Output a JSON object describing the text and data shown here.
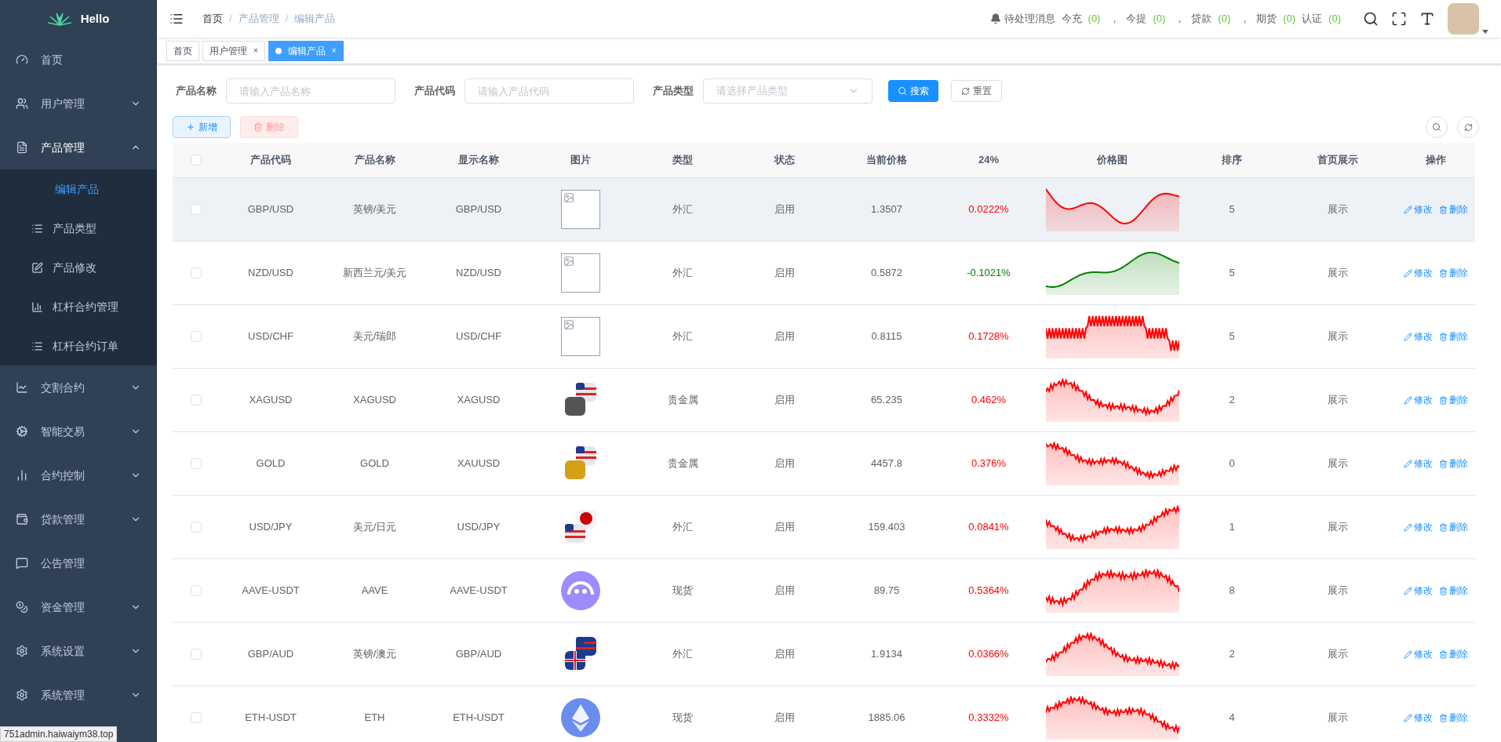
{
  "brand": {
    "name": "Hello"
  },
  "sidebar": {
    "items": [
      {
        "label": "首页",
        "kind": "link"
      },
      {
        "label": "用户管理",
        "kind": "group",
        "expanded": false
      },
      {
        "label": "产品管理",
        "kind": "group",
        "expanded": true,
        "children": [
          {
            "label": "编辑产品",
            "selected": true
          },
          {
            "label": "产品类型",
            "selected": false
          },
          {
            "label": "产品修改",
            "selected": false
          },
          {
            "label": "杠杆合约管理",
            "selected": false
          },
          {
            "label": "杠杆合约订单",
            "selected": false
          }
        ]
      },
      {
        "label": "交割合约",
        "kind": "group",
        "expanded": false
      },
      {
        "label": "智能交易",
        "kind": "group",
        "expanded": false
      },
      {
        "label": "合约控制",
        "kind": "group",
        "expanded": false
      },
      {
        "label": "贷款管理",
        "kind": "group",
        "expanded": false
      },
      {
        "label": "公告管理",
        "kind": "link"
      },
      {
        "label": "资金管理",
        "kind": "group",
        "expanded": false
      },
      {
        "label": "系统设置",
        "kind": "group",
        "expanded": false
      },
      {
        "label": "系统管理",
        "kind": "group",
        "expanded": false
      }
    ]
  },
  "breadcrumb": {
    "separator": "/",
    "items": [
      "首页",
      "产品管理",
      "编辑产品"
    ]
  },
  "notices": {
    "title": "待处理消息",
    "items": [
      {
        "label": "今充",
        "count": "(0)",
        "separator": "，"
      },
      {
        "label": "今提",
        "count": "(0)",
        "separator": "，"
      },
      {
        "label": "贷款",
        "count": "(0)",
        "separator": "，"
      },
      {
        "label": "期货",
        "count": "(0)"
      },
      {
        "label": "认证",
        "count": "(0)"
      }
    ]
  },
  "tabs": [
    {
      "label": "首页",
      "selected": false
    },
    {
      "label": "用户管理",
      "selected": false,
      "close": "×"
    },
    {
      "label": "编辑产品",
      "selected": true,
      "close": "×"
    }
  ],
  "filters": [
    {
      "label": "产品名称",
      "kind": "input",
      "placeholder": "请输入产品名称"
    },
    {
      "label": "产品代码",
      "kind": "input",
      "placeholder": "请输入产品代码"
    },
    {
      "label": "产品类型",
      "kind": "select",
      "placeholder": "请选择产品类型"
    }
  ],
  "search_button": "搜索",
  "reset_button": "重置",
  "toolbar": {
    "add": "新增",
    "delete": "删除",
    "delete_disabled": true
  },
  "table": {
    "select_all": {
      "checked": false
    },
    "columns": [
      "产品代码",
      "产品名称",
      "显示名称",
      "图片",
      "类型",
      "状态",
      "当前价格",
      "24%",
      "价格图",
      "排序",
      "首页展示",
      "操作"
    ],
    "rows": [
      {
        "checked": false,
        "code": "GBP/USD",
        "name": "英镑/美元",
        "display": "GBP/USD",
        "image": {
          "kind": "broken"
        },
        "type": "外汇",
        "status": "启用",
        "price": "1.3507",
        "change": "0.0222%",
        "color": "#ff0000",
        "sort": "5",
        "home": "展示",
        "edit": "修改",
        "delete": "删除",
        "hovered": true
      },
      {
        "checked": false,
        "code": "NZD/USD",
        "name": "新西兰元/美元",
        "display": "NZD/USD",
        "image": {
          "kind": "broken"
        },
        "type": "外汇",
        "status": "启用",
        "price": "0.5872",
        "change": "-0.1021%",
        "color": "#008000",
        "sort": "5",
        "home": "展示",
        "edit": "修改",
        "delete": "删除",
        "hovered": false
      },
      {
        "checked": false,
        "code": "USD/CHF",
        "name": "美元/瑞郎",
        "display": "USD/CHF",
        "image": {
          "kind": "broken"
        },
        "type": "外汇",
        "status": "启用",
        "price": "0.8115",
        "change": "0.1728%",
        "color": "#ff0000",
        "sort": "5",
        "home": "展示",
        "edit": "修改",
        "delete": "删除",
        "hovered": false
      },
      {
        "checked": false,
        "code": "XAGUSD",
        "name": "XAGUSD",
        "display": "XAGUSD",
        "image": {
          "kind": "flags"
        },
        "type": "贵金属",
        "status": "启用",
        "price": "65.235",
        "change": "0.462%",
        "color": "#ff0000",
        "sort": "2",
        "home": "展示",
        "edit": "修改",
        "delete": "删除",
        "hovered": false
      },
      {
        "checked": false,
        "code": "GOLD",
        "name": "GOLD",
        "display": "XAUUSD",
        "image": {
          "kind": "flags"
        },
        "type": "贵金属",
        "status": "启用",
        "price": "4457.8",
        "change": "0.376%",
        "color": "#ff0000",
        "sort": "0",
        "home": "展示",
        "edit": "修改",
        "delete": "删除",
        "hovered": false
      },
      {
        "checked": false,
        "code": "USD/JPY",
        "name": "美元/日元",
        "display": "USD/JPY",
        "image": {
          "kind": "flags"
        },
        "type": "外汇",
        "status": "启用",
        "price": "159.403",
        "change": "0.0841%",
        "color": "#ff0000",
        "sort": "1",
        "home": "展示",
        "edit": "修改",
        "delete": "删除",
        "hovered": false
      },
      {
        "checked": false,
        "code": "AAVE-USDT",
        "name": "AAVE",
        "display": "AAVE-USDT",
        "image": {
          "kind": "coin"
        },
        "type": "现货",
        "status": "启用",
        "price": "89.75",
        "change": "0.5364%",
        "color": "#ff0000",
        "sort": "8",
        "home": "展示",
        "edit": "修改",
        "delete": "删除",
        "hovered": false
      },
      {
        "checked": false,
        "code": "GBP/AUD",
        "name": "英镑/澳元",
        "display": "GBP/AUD",
        "image": {
          "kind": "flags"
        },
        "type": "外汇",
        "status": "启用",
        "price": "1.9134",
        "change": "0.0366%",
        "color": "#ff0000",
        "sort": "2",
        "home": "展示",
        "edit": "修改",
        "delete": "删除",
        "hovered": false
      },
      {
        "checked": false,
        "code": "ETH-USDT",
        "name": "ETH",
        "display": "ETH-USDT",
        "image": {
          "kind": "coin"
        },
        "type": "现货",
        "status": "启用",
        "price": "1885.06",
        "change": "0.3332%",
        "color": "#ff0000",
        "sort": "4",
        "home": "展示",
        "edit": "修改",
        "delete": "删除",
        "hovered": false
      }
    ]
  },
  "status_bar": "751admin.haiwaiym38.top"
}
